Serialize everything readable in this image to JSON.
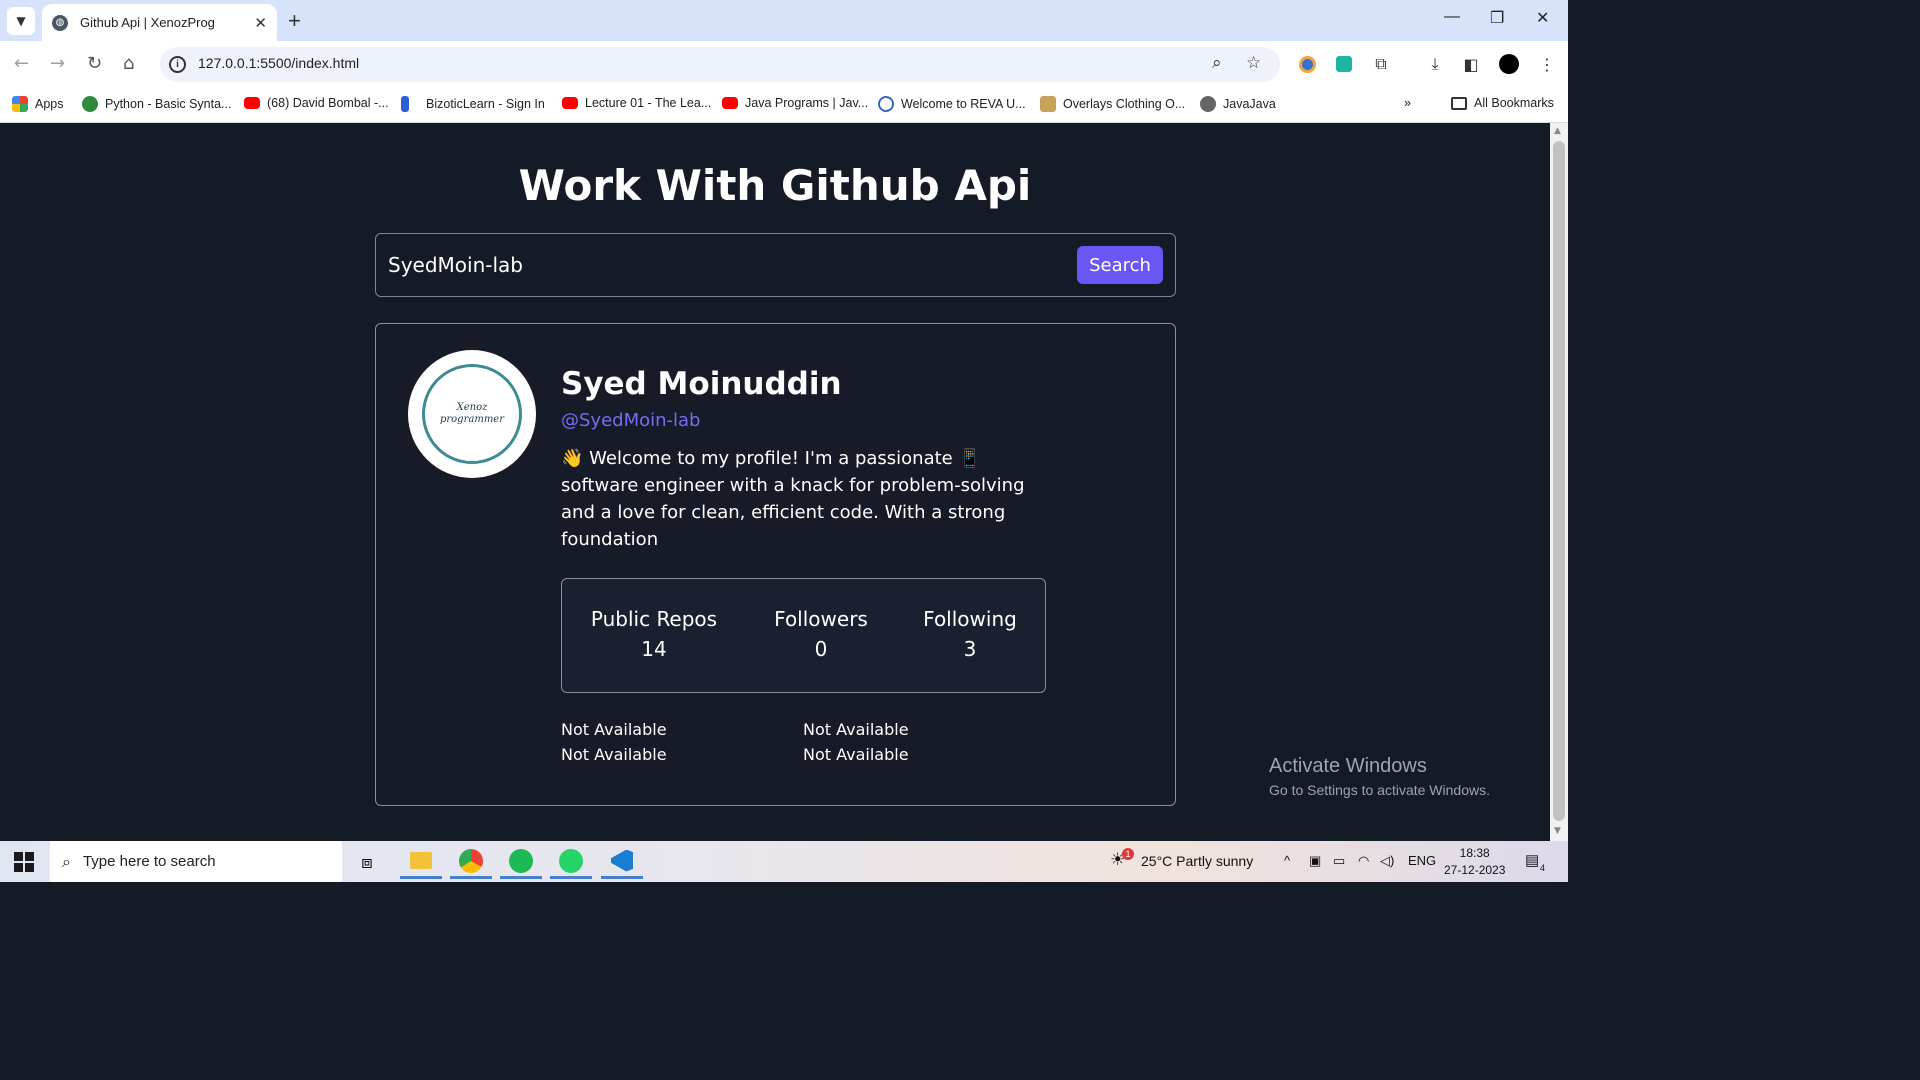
{
  "browser": {
    "tab_title": "Github Api | XenozProg",
    "url": "127.0.0.1:5500/index.html",
    "bookmarks": [
      {
        "label": "Apps"
      },
      {
        "label": "Python - Basic Synta..."
      },
      {
        "label": "(68) David Bombal -..."
      },
      {
        "label": "BizoticLearn - Sign In"
      },
      {
        "label": "Lecture 01 - The Lea..."
      },
      {
        "label": "Java Programs | Jav..."
      },
      {
        "label": "Welcome to REVA U..."
      },
      {
        "label": "Overlays Clothing O..."
      },
      {
        "label": "JavaJava"
      }
    ],
    "all_bookmarks": "All Bookmarks"
  },
  "page": {
    "title": "Work With Github Api",
    "search": {
      "value": "SyedMoin-lab",
      "button": "Search"
    },
    "profile": {
      "avatar_text": "Xenoz programmer",
      "name": "Syed Moinuddin",
      "handle": "@SyedMoin-lab",
      "bio": "👋 Welcome to my profile! I'm a passionate 📱 software engineer with a knack for problem-solving and a love for clean, efficient code. With a strong foundation",
      "stats": {
        "repos_label": "Public Repos",
        "repos_value": "14",
        "followers_label": "Followers",
        "followers_value": "0",
        "following_label": "Following",
        "following_value": "3"
      },
      "links": {
        "location": "Not Available",
        "twitter": "Not Available",
        "website": "Not Available",
        "company": "Not Available"
      }
    },
    "watermark": {
      "line1": "Activate Windows",
      "line2": "Go to Settings to activate Windows."
    }
  },
  "taskbar": {
    "search_placeholder": "Type here to search",
    "weather": "25°C  Partly sunny",
    "language": "ENG",
    "time": "18:38",
    "date": "27-12-2023",
    "notification_count": "4",
    "weather_badge": "1"
  }
}
